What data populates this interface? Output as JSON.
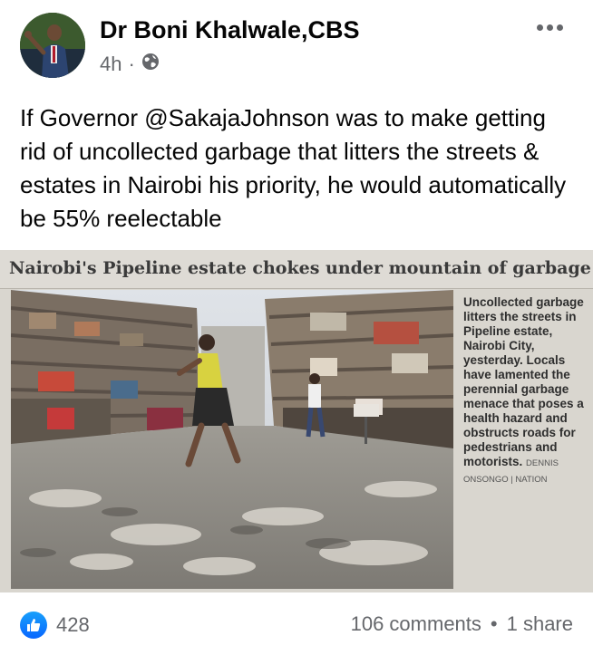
{
  "post": {
    "author": "Dr Boni Khalwale,CBS",
    "time": "4h",
    "separator": "·",
    "text": "If Governor @SakajaJohnson was to make getting rid of uncollected garbage that litters the streets & estates in Nairobi his priority, he would automatically be 55% reelectable"
  },
  "photo": {
    "headline": "Nairobi's Pipeline estate chokes under mountain of garbage",
    "caption": "Uncollected garbage litters the streets in Pipeline estate, Nairobi City, yesterday. Locals have lamented the perennial garbage menace that poses a health hazard and obstructs roads for pedestrians and motorists.",
    "credit": "DENNIS ONSONGO | NATION"
  },
  "footer": {
    "like_count": "428",
    "comments": "106 comments",
    "shares": "1 share",
    "separator": "•"
  },
  "icons": {
    "privacy": "globe-icon",
    "menu": "more-icon",
    "reaction": "like-icon"
  },
  "colors": {
    "accent": "#0866ff",
    "secondary_text": "#65676b"
  }
}
